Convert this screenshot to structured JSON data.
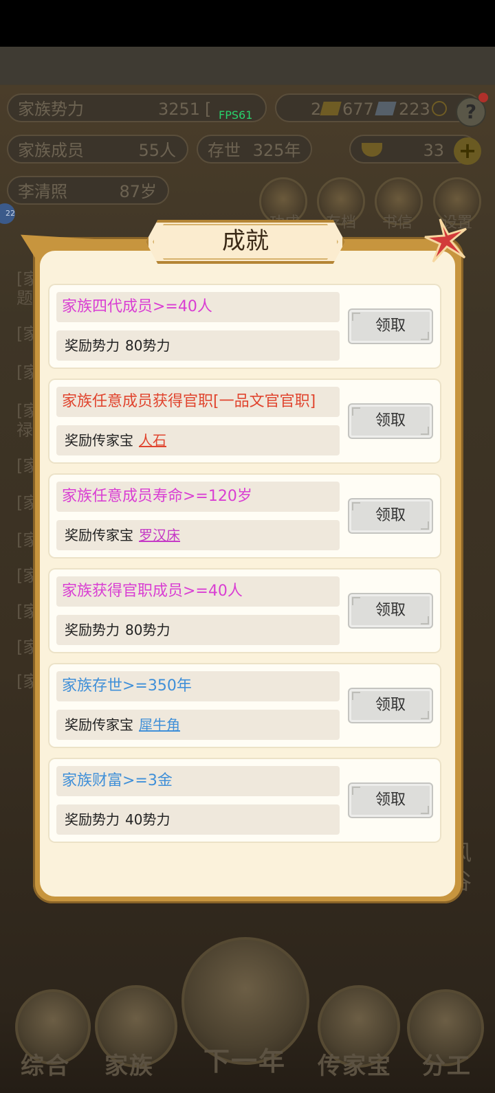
{
  "header": {
    "fps": "FPS61",
    "power_label": "家族势力",
    "power_value": "3251",
    "power_bracket": "[",
    "currency_1": "2",
    "currency_2": "677",
    "currency_3": "223",
    "help": "?",
    "members_label": "家族成员",
    "members_value": "55人",
    "exist_label": "存世",
    "exist_value": "325年",
    "ingots": "33",
    "plus": "+",
    "person_name": "李清照",
    "person_age": "87岁",
    "menu_items": [
      "功成",
      "存档",
      "书信",
      "设置"
    ]
  },
  "background_log": [
    "[家",
    "题",
    "[家",
    "[家",
    "[家",
    "禄",
    "[家",
    "[家",
    "[家",
    "[家",
    "[家",
    "[家",
    "[家"
  ],
  "modal": {
    "title": "成就",
    "achievements": [
      {
        "condition": "家族四代成员>=40人",
        "reward_prefix": "奖励势力",
        "reward_item": "80势力",
        "item_link": false,
        "condition_color": "#d93ed3",
        "item_color": "#222222",
        "button": "领取"
      },
      {
        "condition": "家族任意成员获得官职[一品文官官职]",
        "reward_prefix": "奖励传家宝",
        "reward_item": "人石",
        "item_link": true,
        "condition_color": "#e0442e",
        "item_color": "#e0442e",
        "button": "领取"
      },
      {
        "condition": "家族任意成员寿命>=120岁",
        "reward_prefix": "奖励传家宝",
        "reward_item": "罗汉床",
        "item_link": true,
        "condition_color": "#d93ed3",
        "item_color": "#c53ac6",
        "button": "领取"
      },
      {
        "condition": "家族获得官职成员>=40人",
        "reward_prefix": "奖励势力",
        "reward_item": "80势力",
        "item_link": false,
        "condition_color": "#d93ed3",
        "item_color": "#222222",
        "button": "领取"
      },
      {
        "condition": "家族存世>=350年",
        "reward_prefix": "奖励传家宝",
        "reward_item": "犀牛角",
        "item_link": true,
        "condition_color": "#3f8fd8",
        "item_color": "#3f8fd8",
        "button": "领取"
      },
      {
        "condition": "家族财富>=3金",
        "reward_prefix": "奖励势力",
        "reward_item": "40势力",
        "item_link": false,
        "condition_color": "#3f8fd8",
        "item_color": "#222222",
        "button": "领取"
      }
    ]
  },
  "bottom_nav": {
    "items": [
      "综合",
      "家族",
      "下一年",
      "传家宝",
      "分工"
    ],
    "right_side": [
      "风",
      "谷"
    ]
  }
}
